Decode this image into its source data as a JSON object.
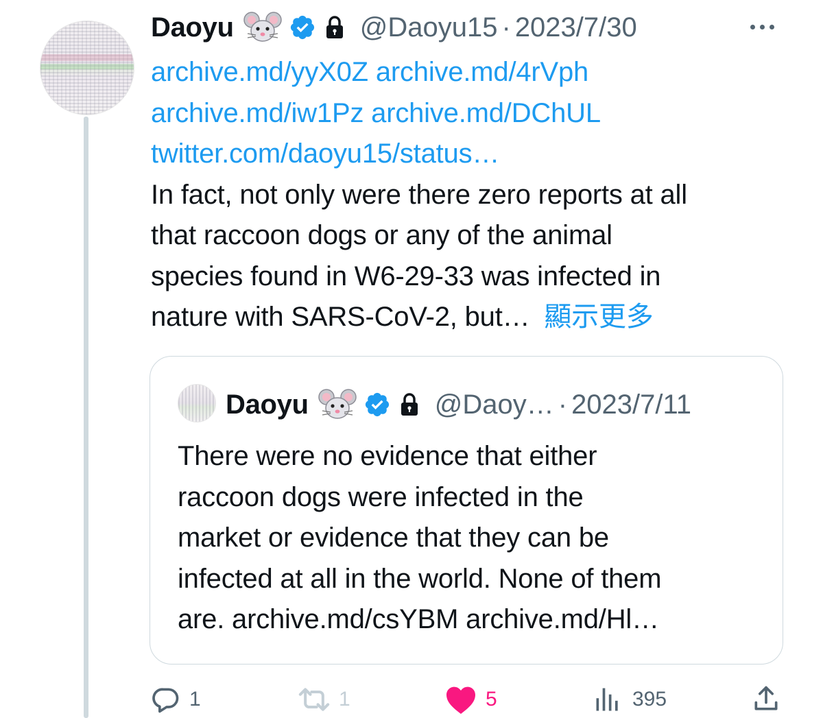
{
  "tweet": {
    "author": {
      "name": "Daoyu",
      "emoji_icon": "mouse-face-emoji",
      "verified": true,
      "protected": true,
      "handle": "@Daoyu15",
      "separator": "·",
      "date": "2023/7/30"
    },
    "links": [
      "archive.md/yyX0Z",
      "archive.md/4rVph",
      "archive.md/iw1Pz",
      "archive.md/DChUL",
      "twitter.com/daoyu15/status…"
    ],
    "text_lines": [
      "In fact, not only were there zero reports at all",
      "that raccoon dogs or any of the animal",
      "species found in W6-29-33 was infected in",
      "nature with SARS-CoV-2, but…"
    ],
    "show_more": "顯示更多"
  },
  "quote": {
    "author": {
      "name": "Daoyu",
      "emoji_icon": "mouse-face-emoji",
      "verified": true,
      "protected": true,
      "handle": "@Daoy…",
      "separator": "·",
      "date": "2023/7/11"
    },
    "text_lines": [
      "There were no evidence that either",
      "raccoon dogs were infected in the",
      "market or evidence that they can be",
      "infected at all in the world. None of them",
      "are. archive.md/csYBM archive.md/Hl…"
    ]
  },
  "actions": {
    "replies": "1",
    "reposts": "1",
    "likes": "5",
    "views": "395"
  },
  "colors": {
    "link": "#1d9bf0",
    "secondary_text": "#536471",
    "like": "#f91880",
    "verified": "#1d9bf0",
    "border": "#cfd9de"
  }
}
